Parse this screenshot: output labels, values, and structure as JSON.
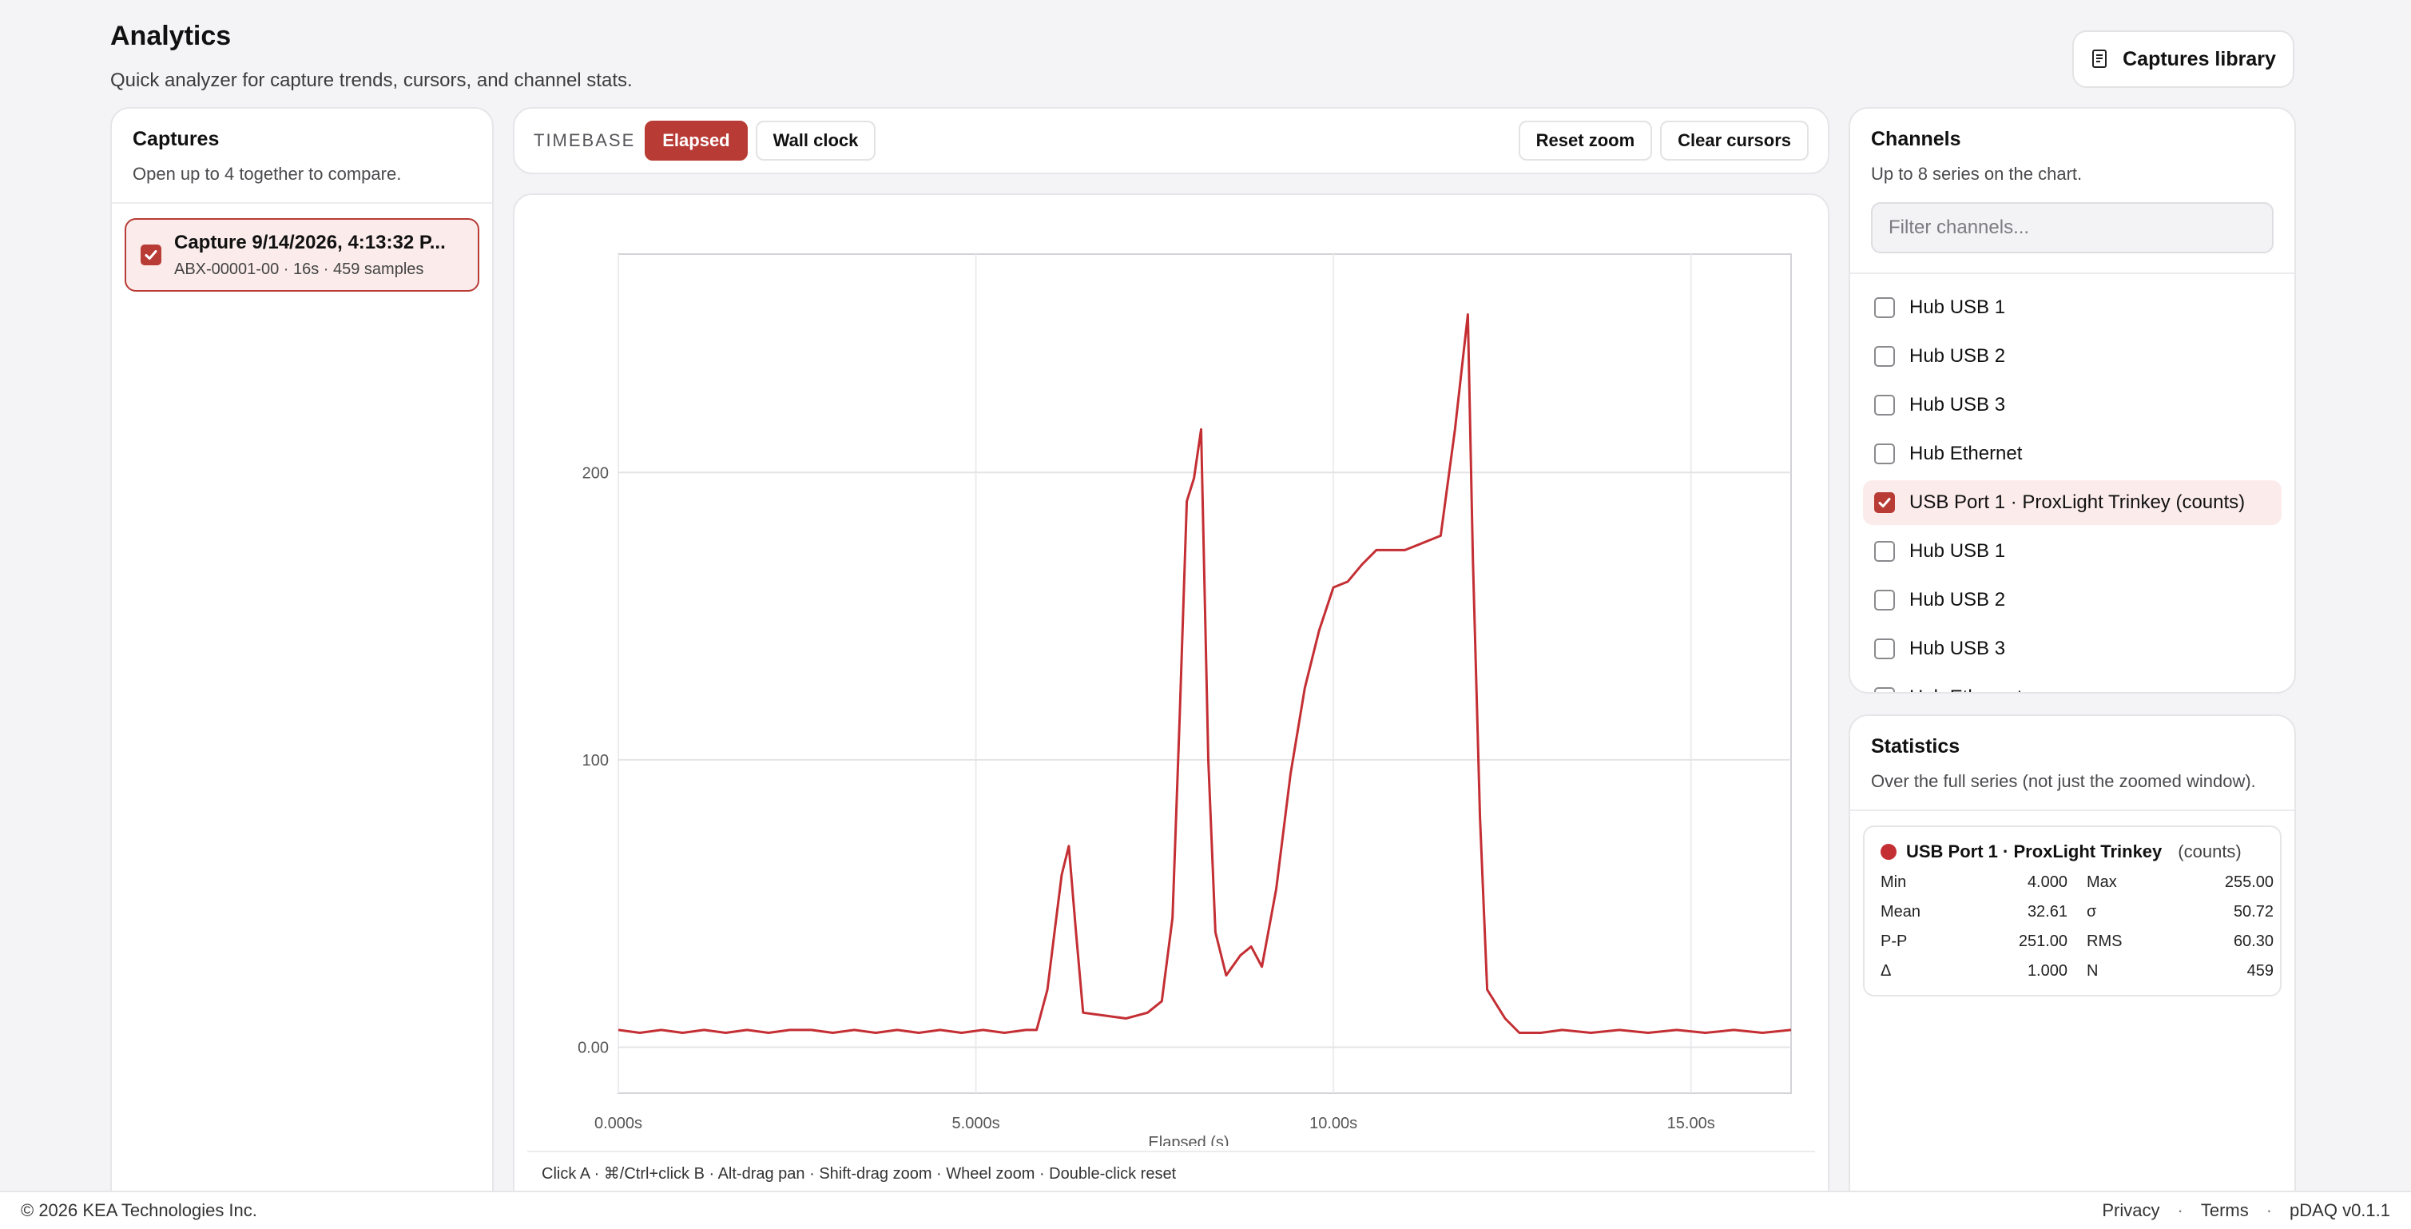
{
  "header": {
    "title": "Analytics",
    "subtitle": "Quick analyzer for capture trends, cursors, and channel stats.",
    "library_button": "Captures library"
  },
  "captures": {
    "title": "Captures",
    "subtitle": "Open up to 4 together to compare.",
    "items": [
      {
        "name": "Capture 9/14/2026, 4:13:32 P...",
        "meta": "ABX-00001-00 · 16s · 459 samples",
        "checked": true
      }
    ]
  },
  "toolbar": {
    "timebase_label": "TIMEBASE",
    "elapsed_label": "Elapsed",
    "wallclock_label": "Wall clock",
    "reset_zoom_label": "Reset zoom",
    "clear_cursors_label": "Clear cursors"
  },
  "chart_hint": "Click A · ⌘/Ctrl+click B · Alt-drag pan · Shift-drag zoom · Wheel zoom · Double-click reset",
  "chart_data": {
    "type": "line",
    "xlabel": "Elapsed (s)",
    "xlim": [
      0,
      16.4
    ],
    "ylim": [
      -16,
      276
    ],
    "x_ticks": [
      0,
      5,
      10,
      15
    ],
    "x_tick_labels": [
      "0.000s",
      "5.000s",
      "10.00s",
      "15.00s"
    ],
    "y_ticks": [
      0,
      100,
      200
    ],
    "y_tick_labels": [
      "0.00",
      "100",
      "200"
    ],
    "grid": true,
    "color": "#c42f34",
    "series": [
      {
        "points": [
          [
            0.0,
            6
          ],
          [
            0.3,
            5
          ],
          [
            0.6,
            6
          ],
          [
            0.9,
            5
          ],
          [
            1.2,
            6
          ],
          [
            1.5,
            5
          ],
          [
            1.8,
            6
          ],
          [
            2.1,
            5
          ],
          [
            2.4,
            6
          ],
          [
            2.7,
            6
          ],
          [
            3.0,
            5
          ],
          [
            3.3,
            6
          ],
          [
            3.6,
            5
          ],
          [
            3.9,
            6
          ],
          [
            4.2,
            5
          ],
          [
            4.5,
            6
          ],
          [
            4.8,
            5
          ],
          [
            5.1,
            6
          ],
          [
            5.4,
            5
          ],
          [
            5.7,
            6
          ],
          [
            5.85,
            6
          ],
          [
            6.0,
            20
          ],
          [
            6.1,
            40
          ],
          [
            6.2,
            60
          ],
          [
            6.3,
            70
          ],
          [
            6.4,
            40
          ],
          [
            6.5,
            12
          ],
          [
            6.8,
            11
          ],
          [
            7.1,
            10
          ],
          [
            7.4,
            12
          ],
          [
            7.6,
            16
          ],
          [
            7.75,
            45
          ],
          [
            7.85,
            115
          ],
          [
            7.95,
            190
          ],
          [
            8.05,
            198
          ],
          [
            8.15,
            215
          ],
          [
            8.25,
            100
          ],
          [
            8.35,
            40
          ],
          [
            8.5,
            25
          ],
          [
            8.7,
            32
          ],
          [
            8.85,
            35
          ],
          [
            9.0,
            28
          ],
          [
            9.2,
            55
          ],
          [
            9.4,
            95
          ],
          [
            9.6,
            125
          ],
          [
            9.8,
            145
          ],
          [
            10.0,
            160
          ],
          [
            10.2,
            162
          ],
          [
            10.4,
            168
          ],
          [
            10.6,
            173
          ],
          [
            11.0,
            173
          ],
          [
            11.5,
            178
          ],
          [
            11.7,
            215
          ],
          [
            11.88,
            255
          ],
          [
            11.95,
            170
          ],
          [
            12.05,
            80
          ],
          [
            12.15,
            20
          ],
          [
            12.4,
            10
          ],
          [
            12.6,
            5
          ],
          [
            12.9,
            5
          ],
          [
            13.2,
            6
          ],
          [
            13.6,
            5
          ],
          [
            14.0,
            6
          ],
          [
            14.4,
            5
          ],
          [
            14.8,
            6
          ],
          [
            15.2,
            5
          ],
          [
            15.6,
            6
          ],
          [
            16.0,
            5
          ],
          [
            16.4,
            6
          ]
        ]
      }
    ]
  },
  "channels": {
    "title": "Channels",
    "subtitle": "Up to 8 series on the chart.",
    "filter_placeholder": "Filter channels...",
    "items": [
      {
        "label": "Hub USB 1",
        "checked": false
      },
      {
        "label": "Hub USB 2",
        "checked": false
      },
      {
        "label": "Hub USB 3",
        "checked": false
      },
      {
        "label": "Hub Ethernet",
        "checked": false
      },
      {
        "label": "USB Port 1 · ProxLight Trinkey (counts)",
        "checked": true
      },
      {
        "label": "Hub USB 1",
        "checked": false
      },
      {
        "label": "Hub USB 2",
        "checked": false
      },
      {
        "label": "Hub USB 3",
        "checked": false
      },
      {
        "label": "Hub Ethernet",
        "checked": false
      }
    ]
  },
  "statistics": {
    "title": "Statistics",
    "subtitle": "Over the full series (not just the zoomed window).",
    "series_name": "USB Port 1 · ProxLight Trinkey",
    "series_unit": "(counts)",
    "rows": [
      {
        "l1": "Min",
        "v1": "4.000",
        "l2": "Max",
        "v2": "255.00"
      },
      {
        "l1": "Mean",
        "v1": "32.61",
        "l2": "σ",
        "v2": "50.72"
      },
      {
        "l1": "P-P",
        "v1": "251.00",
        "l2": "RMS",
        "v2": "60.30"
      },
      {
        "l1": "Δ",
        "v1": "1.000",
        "l2": "N",
        "v2": "459"
      }
    ]
  },
  "footer": {
    "copyright": "© 2026 KEA Technologies Inc.",
    "privacy": "Privacy",
    "terms": "Terms",
    "version": "pDAQ v0.1.1",
    "separator": "·"
  }
}
